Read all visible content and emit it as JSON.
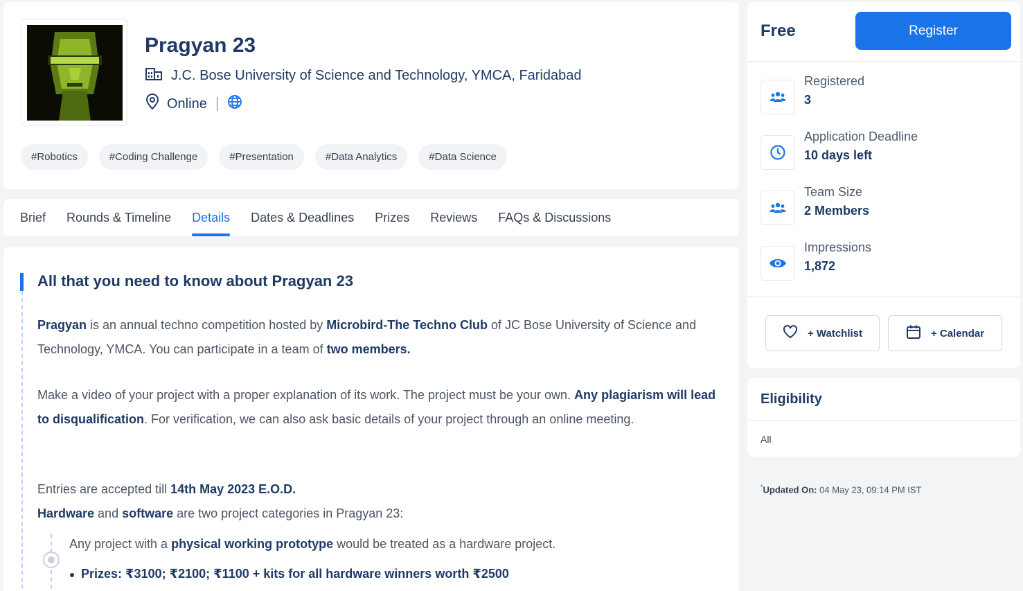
{
  "event": {
    "title": "Pragyan 23",
    "organization": "J.C. Bose University of Science and Technology, YMCA, Faridabad",
    "mode": "Online",
    "tags": [
      "#Robotics",
      "#Coding Challenge",
      "#Presentation",
      "#Data Analytics",
      "#Data Science"
    ]
  },
  "tabs": [
    {
      "label": "Brief"
    },
    {
      "label": "Rounds & Timeline"
    },
    {
      "label": "Details"
    },
    {
      "label": "Dates & Deadlines"
    },
    {
      "label": "Prizes"
    },
    {
      "label": "Reviews"
    },
    {
      "label": "FAQs & Discussions"
    }
  ],
  "active_tab": "Details",
  "details": {
    "heading": "All that you need to know about Pragyan 23",
    "p1": {
      "b1": "Pragyan",
      "t1": " is an annual techno competition hosted by ",
      "b2": "Microbird-The Techno Club",
      "t2": " of JC Bose University of Science and Technology, YMCA. You can participate in a team of ",
      "b3": "two members."
    },
    "p2": {
      "t1": "Make a video of your project with a proper explanation of its work. The project must be your own. ",
      "b1": "Any plagiarism will lead to disqualification",
      "t2": ". For verification, we can also ask basic details of your project through an online meeting."
    },
    "p3": {
      "t1": "Entries are accepted till ",
      "b1": "14th May 2023 E.O.D."
    },
    "p4": {
      "b1": "Hardware",
      "t1": " and ",
      "b2": "software",
      "t2": " are two project categories in Pragyan 23:"
    },
    "hw": {
      "t1": "Any project with a ",
      "b1": "physical working prototype",
      "t2": " would be treated as a hardware project."
    },
    "prizes": "Prizes: ₹3100; ₹2100; ₹1100 + kits for all hardware winners worth ₹2500"
  },
  "sidebar": {
    "price": "Free",
    "register_label": "Register",
    "stats": [
      {
        "label": "Registered",
        "value": "3",
        "icon": "users-icon"
      },
      {
        "label": "Application Deadline",
        "value": "10 days left",
        "icon": "clock-icon"
      },
      {
        "label": "Team Size",
        "value": "2 Members",
        "icon": "team-icon"
      },
      {
        "label": "Impressions",
        "value": "1,872",
        "icon": "eye-icon"
      }
    ],
    "watchlist_label": "+ Watchlist",
    "calendar_label": "+ Calendar",
    "eligibility_title": "Eligibility",
    "eligibility_value": "All",
    "updated_prefix": "*",
    "updated_label": "Updated On:",
    "updated_value": " 04 May 23, 09:14 PM IST"
  },
  "colors": {
    "accent": "#1a73e8",
    "heading": "#1f3a64"
  }
}
